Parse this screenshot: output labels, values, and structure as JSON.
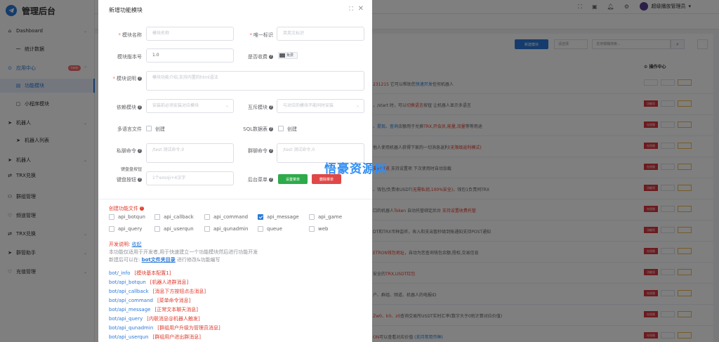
{
  "app": {
    "title": "管理后台"
  },
  "sidebar": {
    "items": [
      {
        "label": "Dashboard",
        "icon": "home-icon"
      },
      {
        "label": "统计数据",
        "icon": "chart-icon"
      },
      {
        "label": "应用中心",
        "icon": "app-icon",
        "badge": "new"
      },
      {
        "label": "功能模块",
        "icon": "module-icon"
      },
      {
        "label": "小程序模块",
        "icon": "miniapp-icon"
      },
      {
        "label": "机器人",
        "icon": "send-icon"
      },
      {
        "label": "机器人列表",
        "icon": "send-icon"
      },
      {
        "label": "机器人",
        "icon": "send-icon"
      },
      {
        "label": "TRX兑换",
        "icon": "exchange-icon"
      },
      {
        "label": "群组管理",
        "icon": "group-icon"
      },
      {
        "label": "频道管理",
        "icon": "heart-icon"
      },
      {
        "label": "TRX兑换",
        "icon": "exchange-icon"
      },
      {
        "label": "群管助手",
        "icon": "send-icon"
      },
      {
        "label": "充值管理",
        "icon": "heart-icon"
      }
    ]
  },
  "topbar": {
    "user_name": "超级播放管理员"
  },
  "background": {
    "new_button": "新建模块",
    "select_placeholder": "请选择",
    "search_placeholder": "支持模糊搜索...",
    "ops_header": "操作中心",
    "rows": [
      {
        "segments": [
          [
            "231215",
            "red"
          ],
          [
            " 它可以帮助您",
            ""
          ],
          [
            "快速开发",
            "blue"
          ],
          [
            "任何机器人",
            ""
          ]
        ],
        "op1": "",
        "op2": "",
        "op3": ""
      },
      {
        "segments": [
          [
            "，/start 时，可以",
            ""
          ],
          [
            "切换语言",
            "red"
          ],
          [
            "按钮 让机器人显示多语言",
            ""
          ]
        ],
        "op1": "功能项",
        "op2": "",
        "op3": ""
      },
      {
        "segments": [
          [
            "、",
            ""
          ],
          [
            "提现",
            "blue"
          ],
          [
            "、",
            ""
          ],
          [
            "查询",
            "blue"
          ],
          [
            "余额用于兑换",
            ""
          ],
          [
            "TRX,开会员,能量,流量",
            "red"
          ],
          [
            "等等用途",
            ""
          ]
        ],
        "op1": "在权限",
        "op2": "",
        "op3": ""
      },
      {
        "segments": [
          [
            "他人使用机器人获得下家的一切消息返利",
            ""
          ],
          [
            "(无限级返利模式)",
            "red"
          ]
        ],
        "op1": "在权限",
        "op2": "",
        "op3": ""
      },
      {
        "segments": [
          [
            "支持预览",
            "red"
          ],
          [
            " 支持设置项 下次使用时自动加载",
            ""
          ]
        ],
        "op1": "在权限",
        "op2": "",
        "op3": ""
      },
      {
        "segments": [
          [
            "、钱包/负责收USDT",
            ""
          ],
          [
            "(无需私钥,100%安全)",
            "red"
          ],
          [
            "，钱包1负责同TRX",
            ""
          ]
        ],
        "op1": "功能项",
        "op2": "",
        "op3": ""
      },
      {
        "segments": [
          [
            "口的机器人",
            ""
          ],
          [
            "Token",
            "red"
          ],
          [
            " 自动托管绑定后台 ",
            ""
          ],
          [
            "支持设置收费托管",
            "red"
          ]
        ],
        "op1": "在权限",
        "op2": "",
        "op3": ""
      },
      {
        "segments": [
          [
            "DT和TRX币种监听，收入和支出暂秒级到账通知支持POST通知",
            ""
          ]
        ],
        "op1": "功能项",
        "op2": "",
        "op3": ""
      },
      {
        "segments": [
          [
            "ETRON钱包地址",
            "red"
          ],
          [
            "，自动为您查询钱包余额,授权,交易信息",
            ""
          ]
        ],
        "op1": "在权限",
        "op2": "",
        "op3": ""
      },
      {
        "segments": [
          [
            "安全的",
            ""
          ],
          [
            "TRX,USDT红包",
            "red"
          ]
        ],
        "op1": "功能项",
        "op2": "",
        "op3": ""
      },
      {
        "segments": [
          [
            "户、群组、频道、机器人的电报ID",
            ""
          ]
        ],
        "op1": "在权限",
        "op2": "",
        "op3": ""
      },
      {
        "segments": [
          [
            "Z",
            "red"
          ],
          [
            "w0",
            "red"
          ],
          [
            "、",
            ""
          ],
          [
            "k0",
            "red"
          ],
          [
            "、",
            ""
          ],
          [
            "z0",
            "red"
          ],
          [
            "查询交易所USDT实时汇率(数字大于0则计算对应价值)",
            ""
          ]
        ],
        "op1": "在权限",
        "op2": "",
        "op3": ""
      },
      {
        "segments": [
          [
            "ON",
            "red"
          ],
          [
            "可以查看对应价值 ",
            ""
          ],
          [
            "(支持常用币种)",
            "blue"
          ]
        ],
        "op1": "在权限",
        "op2": "",
        "op3": ""
      }
    ]
  },
  "dialog": {
    "title": "新增功能模块",
    "fields": {
      "name_label": "模块名称",
      "name_placeholder": "模块名称",
      "id_label": "唯一标识",
      "id_placeholder": "英英文标识",
      "version_label": "模块版本号",
      "version_value": "1.0",
      "charge_label": "是否收费",
      "charge_toggle": "免费",
      "desc_label": "模块说明",
      "desc_placeholder": "模块功能介绍,支持内置的html语法",
      "dep_label": "依赖模块",
      "dep_placeholder": "安装前必须安装对应模块",
      "mutex_label": "互斥模块",
      "mutex_placeholder": "与对应的模块不能同时安装",
      "lang_label": "多语言文件",
      "lang_cb": "创建",
      "sql_label": "SQL数据表",
      "sql_cb": "创建",
      "private_label": "私聊命令",
      "private_placeholder": "/test 测试命令,0",
      "group_label": "群聊命令",
      "group_placeholder": "/test 测试命令,0",
      "kb_prefix": "键盘盘按钮",
      "kb_label": "键盘按钮",
      "kb_placeholder": "1个emoji+4汉字",
      "menu_label": "后台菜单",
      "menu_set_btn": "设置菜单",
      "menu_del_btn": "删除菜单"
    },
    "create_files": {
      "title": "创建功能文件",
      "items": [
        {
          "label": "api_botqun",
          "checked": false
        },
        {
          "label": "api_callback",
          "checked": false
        },
        {
          "label": "api_command",
          "checked": false
        },
        {
          "label": "api_message",
          "checked": true
        },
        {
          "label": "api_game",
          "checked": false
        },
        {
          "label": "api_query",
          "checked": false
        },
        {
          "label": "api_userqun",
          "checked": false
        },
        {
          "label": "api_qunadmin",
          "checked": false
        },
        {
          "label": "queue",
          "checked": false
        },
        {
          "label": "web",
          "checked": false
        }
      ]
    },
    "dev_notes": {
      "title": "开发说明:",
      "title_link": "收起",
      "line1": "本功能仅适用于开发者,用于快速建立一个功能模块然后进行功能开发",
      "line2_prefix": "新建后可以在:",
      "line2_link": "bot文件夹目录",
      "line2_suffix": " 进行修改&功能编写"
    },
    "files": [
      {
        "path": "bot/_info",
        "note": "[模块基本配置1]"
      },
      {
        "path": "bot/api_botqun",
        "note": "[机器人进群消息]"
      },
      {
        "path": "bot/api_callback",
        "note": "[消息下方按钮点击消息]"
      },
      {
        "path": "bot/api_command",
        "note": "[菜单命令消息]"
      },
      {
        "path": "bot/api_message",
        "note": "[正常文本聊天消息]"
      },
      {
        "path": "bot/api_query",
        "note": "[内联消息@机器人触发]"
      },
      {
        "path": "bot/api_qunadmin",
        "note": "[群组用户升级为管理员消息]"
      },
      {
        "path": "bot/api_userqun",
        "note": "[群组用户进出群消息]"
      }
    ]
  },
  "watermark": "悟豪资源网"
}
